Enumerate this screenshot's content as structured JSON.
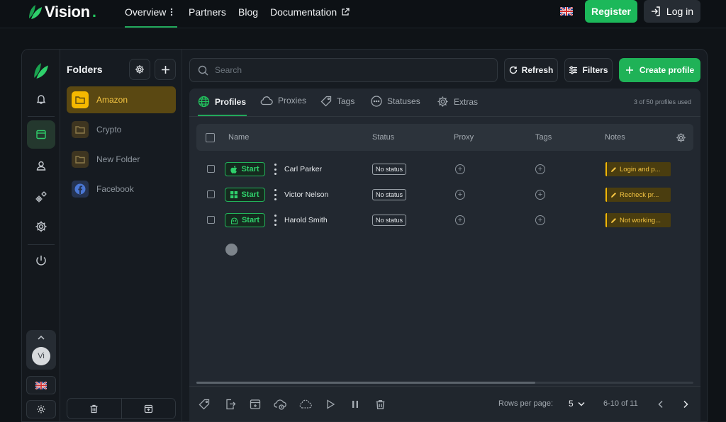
{
  "brand": {
    "name": "Vision",
    "dot": "."
  },
  "topnav": {
    "links": [
      {
        "label": "Overview"
      },
      {
        "label": "Partners"
      },
      {
        "label": "Blog"
      },
      {
        "label": "Documentation"
      }
    ],
    "register_label": "Register",
    "login_label": "Log in"
  },
  "folders": {
    "title": "Folders",
    "items": [
      {
        "label": "Amazon",
        "icon": "folder-icon",
        "active": true
      },
      {
        "label": "Crypto",
        "icon": "folder-icon"
      },
      {
        "label": "New Folder",
        "icon": "folder-icon"
      },
      {
        "label": "Facebook",
        "icon": "facebook-icon"
      }
    ]
  },
  "rail": {
    "avatar_initials": "Vi"
  },
  "toolbar": {
    "search_placeholder": "Search",
    "refresh_label": "Refresh",
    "filters_label": "Filters",
    "create_label": "Create profile"
  },
  "tabs": {
    "items": [
      {
        "label": "Profiles",
        "icon": "globe-icon"
      },
      {
        "label": "Proxies",
        "icon": "cloud-icon"
      },
      {
        "label": "Tags",
        "icon": "tag-icon"
      },
      {
        "label": "Statuses",
        "icon": "dots-circle-icon"
      },
      {
        "label": "Extras",
        "icon": "gear-icon"
      }
    ],
    "usage": "3 of 50 profiles used"
  },
  "table": {
    "columns": [
      "Name",
      "Status",
      "Proxy",
      "Tags",
      "Notes"
    ],
    "rows": [
      {
        "os_icon": "apple-icon",
        "start_label": "Start",
        "name": "Carl Parker",
        "status": "No status",
        "note": "Login and p..."
      },
      {
        "os_icon": "windows-icon",
        "start_label": "Start",
        "name": "Victor Nelson",
        "status": "No status",
        "note": "Recheck pr..."
      },
      {
        "os_icon": "android-icon",
        "start_label": "Start",
        "name": "Harold Smith",
        "status": "No status",
        "note": "Not working..."
      }
    ]
  },
  "pagination": {
    "rows_label": "Rows per page:",
    "rows_value": "5",
    "range": "6-10 of 11"
  },
  "colors": {
    "accent": "#1fb257",
    "folder_active": "#f5c542"
  }
}
